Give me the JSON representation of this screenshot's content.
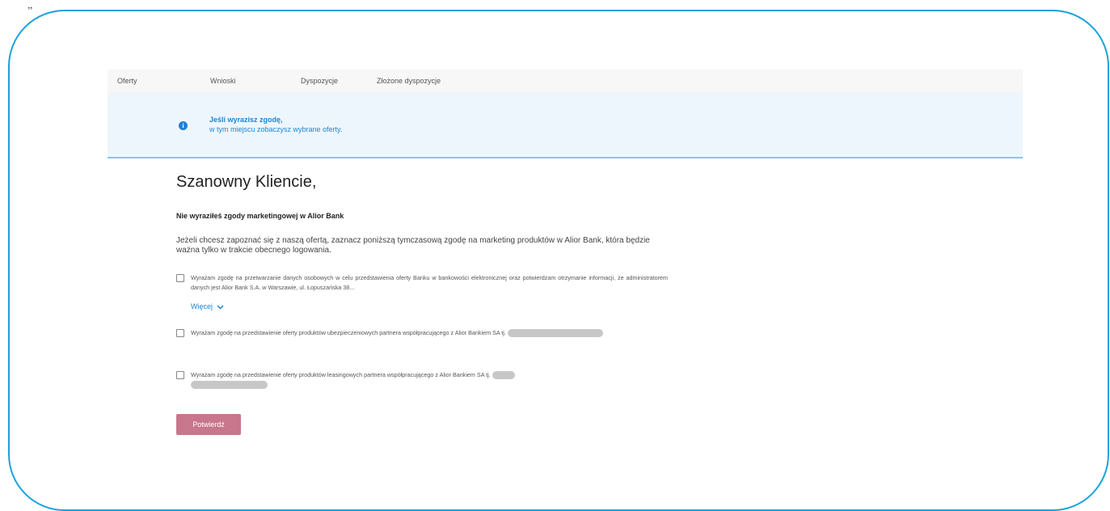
{
  "quote_mark": "„",
  "nav": {
    "tabs": [
      {
        "label": "Oferty"
      },
      {
        "label": "Wnioski"
      },
      {
        "label": "Dyspozycje"
      },
      {
        "label": "Złożone dyspozycje"
      }
    ]
  },
  "banner": {
    "icon": "info-icon",
    "icon_glyph": "i",
    "line1": "Jeśli wyrazisz zgodę,",
    "line2": "w tym miejscu zobaczysz wybrane oferty."
  },
  "main": {
    "greeting": "Szanowny Kliencie,",
    "subtitle": "Nie wyraziłeś zgody marketingowej w Alior Bank",
    "intro": "Jeżeli chcesz zapoznać się z naszą ofertą, zaznacz poniższą tymczasową zgodę na marketing produktów w Alior Bank, która będzie ważna tylko w trakcie obecnego logowania."
  },
  "consents": [
    {
      "text": "Wyrażam zgodę na przetwarzanie danych osobowych w celu przedstawienia oferty Banku w bankowości elektronicznej oraz potwierdzam otrzymanie informacji, że administratorem danych jest Alior Bank S.A. w Warszawie, ul. Łopuszańska 38...",
      "more_label": "Więcej",
      "checked": false
    },
    {
      "text": "Wyrażam zgodę na przedstawienie oferty produktów ubezpieczeniowych partnera współpracującego z Alior Bankiem SA tj.",
      "checked": false
    },
    {
      "text": "Wyrażam zgodę na przedstawienie oferty produktów leasingowych partnera współpracującego z Alior Bankiem SA tj.",
      "checked": false
    }
  ],
  "confirm_label": "Potwierdź",
  "colors": {
    "frame": "#1aa3dc",
    "accent_blue": "#1a86d8",
    "banner_bg": "#eef6fd",
    "button_bg": "#c8768c"
  }
}
